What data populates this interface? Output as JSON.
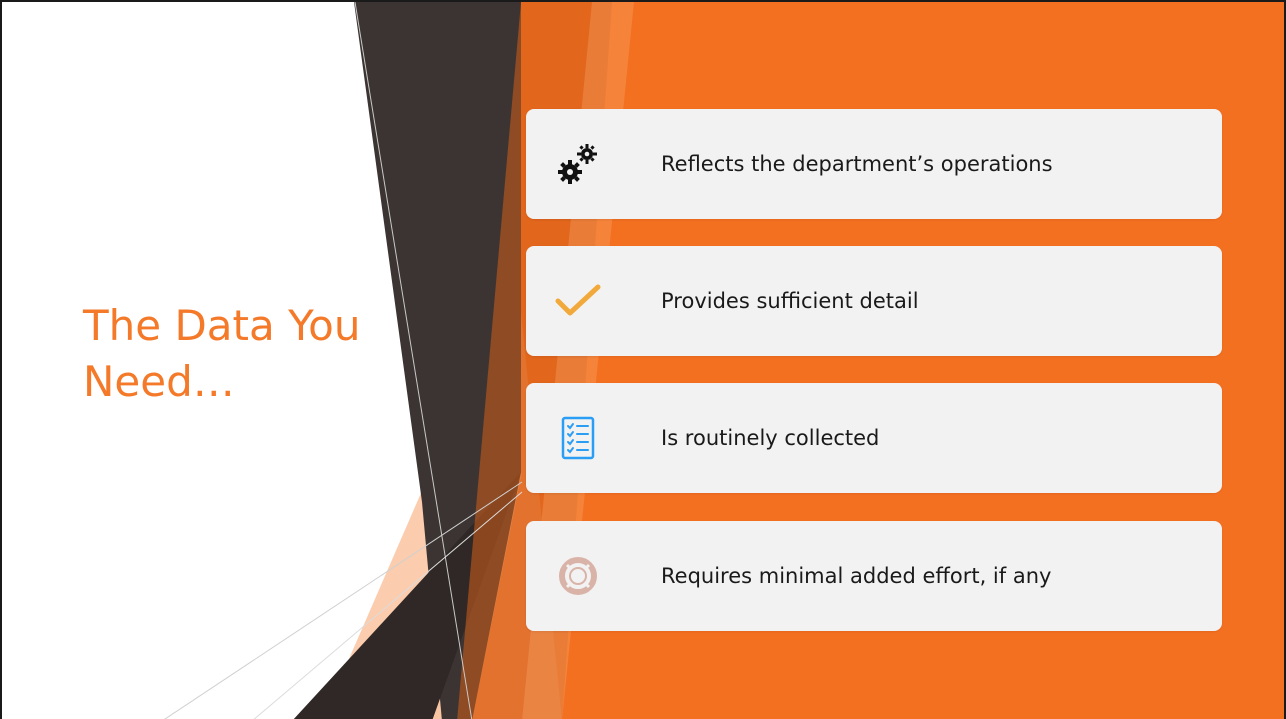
{
  "slide": {
    "title": "The Data You\nNeed…",
    "items": [
      {
        "icon": "gears-icon",
        "label": "Reflects the department’s operations"
      },
      {
        "icon": "checkmark-icon",
        "label": "Provides sufficient detail"
      },
      {
        "icon": "checklist-icon",
        "label": "Is routinely collected"
      },
      {
        "icon": "lifebuoy-icon",
        "label": "Requires minimal added effort, if any"
      }
    ]
  },
  "colors": {
    "accent": "#f47a2a",
    "accent_light": "#f9b487",
    "dark_band": "#3b3432",
    "card_bg": "#f2f2f2",
    "check": "#f2a93b",
    "checklist": "#2a9df4",
    "lifebuoy": "#d9b3a8"
  }
}
